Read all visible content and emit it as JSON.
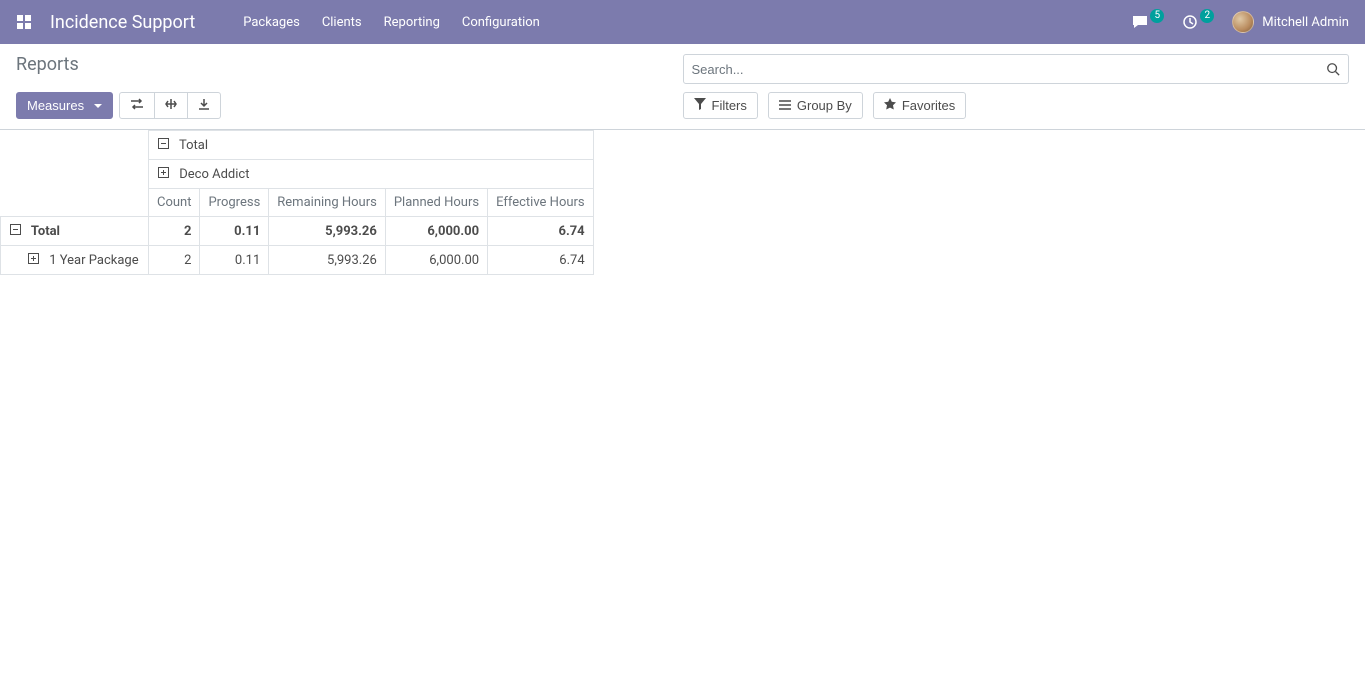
{
  "navbar": {
    "app_title": "Incidence Support",
    "menu": [
      "Packages",
      "Clients",
      "Reporting",
      "Configuration"
    ],
    "messages_badge": "5",
    "activities_badge": "2",
    "user_name": "Mitchell Admin"
  },
  "control_panel": {
    "breadcrumb": "Reports",
    "search_placeholder": "Search...",
    "measures_label": "Measures",
    "filters_label": "Filters",
    "groupby_label": "Group By",
    "favorites_label": "Favorites"
  },
  "pivot": {
    "col_total_label": "Total",
    "col_group_label": "Deco Addict",
    "measure_headers": [
      "Count",
      "Progress",
      "Remaining Hours",
      "Planned Hours",
      "Effective Hours"
    ],
    "rows": {
      "total": {
        "label": "Total",
        "count": "2",
        "progress": "0.11",
        "remaining": "5,993.26",
        "planned": "6,000.00",
        "effective": "6.74"
      },
      "r1": {
        "label": "1 Year Package",
        "count": "2",
        "progress": "0.11",
        "remaining": "5,993.26",
        "planned": "6,000.00",
        "effective": "6.74"
      }
    }
  }
}
